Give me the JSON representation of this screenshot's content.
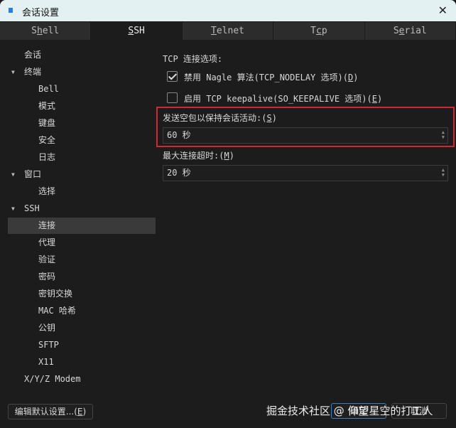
{
  "window": {
    "title": "会话设置",
    "close": "✕"
  },
  "tabs": [
    {
      "pre": "S",
      "key": "h",
      "post": "ell"
    },
    {
      "pre": "",
      "key": "S",
      "post": "SH"
    },
    {
      "pre": "",
      "key": "T",
      "post": "elnet"
    },
    {
      "pre": "T",
      "key": "c",
      "post": "p"
    },
    {
      "pre": "S",
      "key": "e",
      "post": "rial"
    }
  ],
  "tree": [
    "会话",
    "终端",
    "Bell",
    "模式",
    "键盘",
    "安全",
    "日志",
    "窗口",
    "选择",
    "SSH",
    "连接",
    "代理",
    "验证",
    "密码",
    "密钥交换",
    "MAC 哈希",
    "公钥",
    "SFTP",
    "X11",
    "X/Y/Z Modem"
  ],
  "tcp": {
    "heading": "TCP 连接选项:",
    "nagle": {
      "label": "禁用 Nagle 算法(TCP_NODELAY 选项)(",
      "key": "D",
      "end": ")",
      "checked": true
    },
    "keepalive": {
      "label": "启用 TCP keepalive(SO_KEEPALIVE 选项)(",
      "key": "E",
      "end": ")",
      "checked": false
    }
  },
  "keepalive_interval": {
    "label": "发送空包以保持会话活动:(",
    "key": "S",
    "end": ")",
    "value": "60 秒"
  },
  "max_timeout": {
    "label": "最大连接超时:(",
    "key": "M",
    "end": ")",
    "value": "20 秒"
  },
  "buttons": {
    "edit_default": "编辑默认设置...(",
    "edit_key": "E",
    "edit_end": ")",
    "ok": "确定",
    "cancel": "取消"
  },
  "watermark": "掘金技术社区 @ 仰望星空的打工人",
  "colors": {
    "highlight": "#d2282f",
    "accent": "#2a7de1"
  }
}
